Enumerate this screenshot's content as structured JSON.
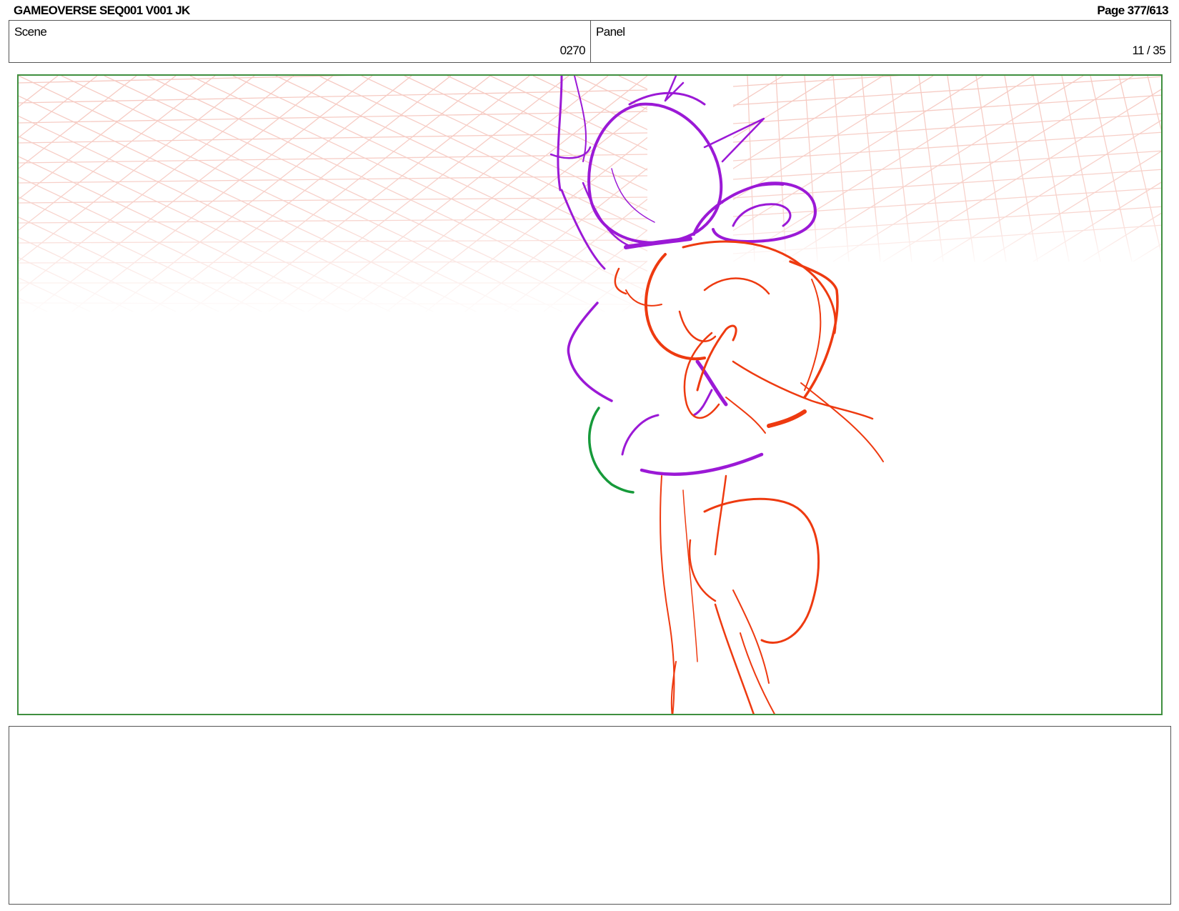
{
  "header": {
    "title": "GAMEOVERSE SEQ001 V001 JK",
    "page": "Page 377/613"
  },
  "scene": {
    "label": "Scene",
    "value": "0270"
  },
  "panel": {
    "label": "Panel",
    "value": "11 / 35"
  },
  "sketch": {
    "colors": {
      "background_grid": "#f3b8ad",
      "character_purple": "#9b19d6",
      "character_red": "#ee3a10",
      "accent_green": "#169a3a",
      "frame_border": "#3f8f3f"
    }
  },
  "notes": {
    "text": ""
  }
}
